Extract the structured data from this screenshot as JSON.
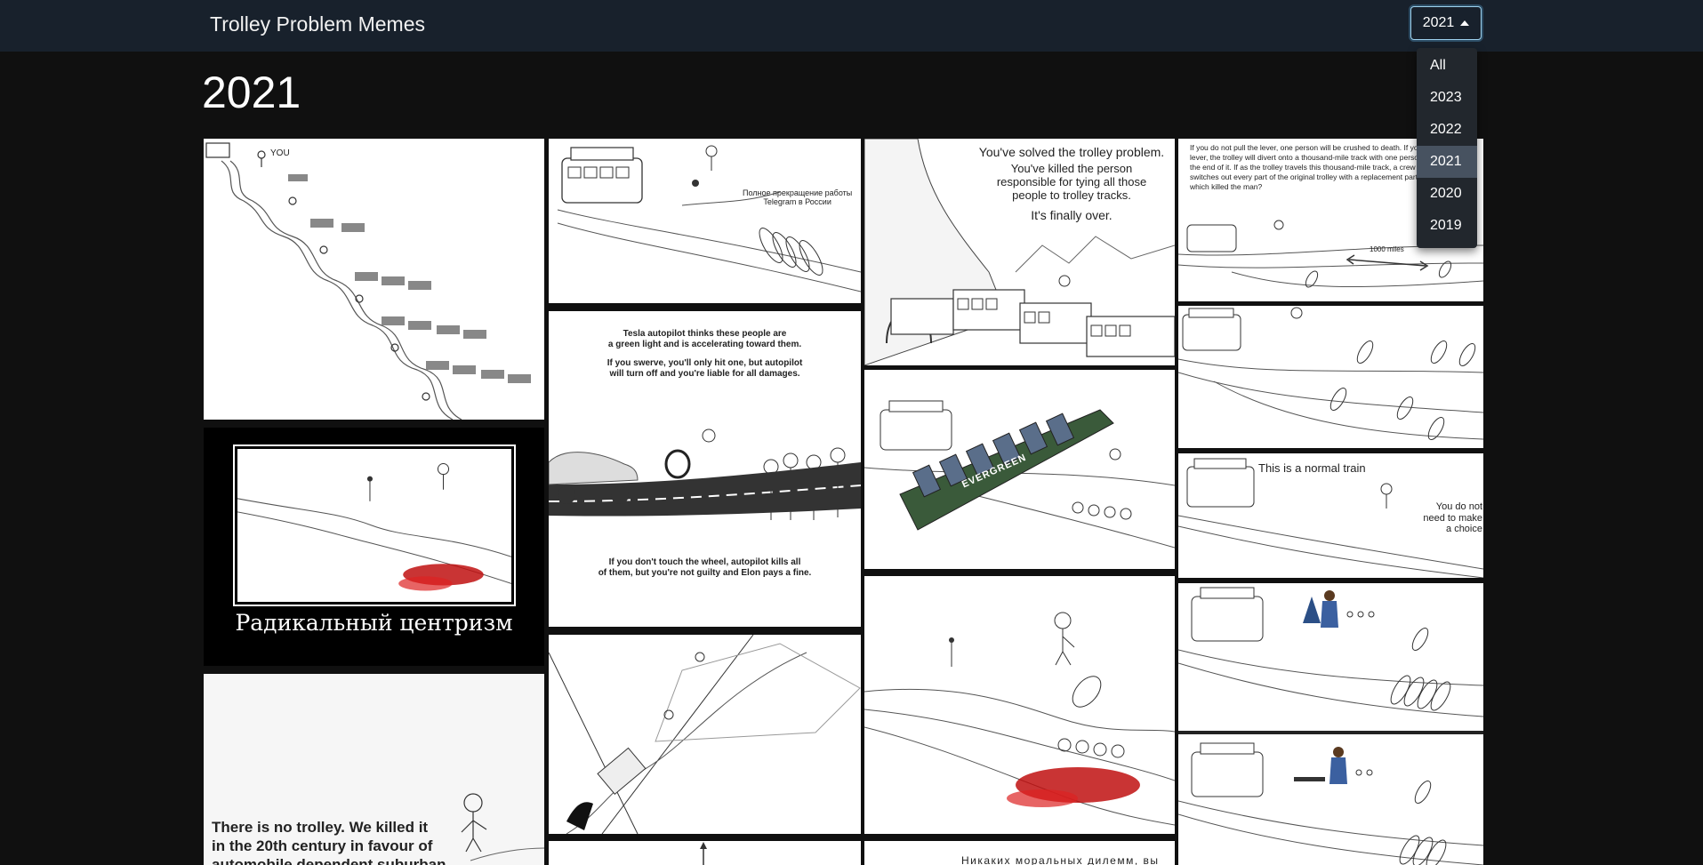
{
  "navbar": {
    "brand": "Trolley Problem Memes"
  },
  "year_selector": {
    "selected": "2021",
    "options": [
      "All",
      "2023",
      "2022",
      "2021",
      "2020",
      "2019"
    ]
  },
  "page": {
    "title": "2021"
  },
  "memes": {
    "m1_you": "YOU",
    "m2_caption_line1": "Полное прекращение работы",
    "m2_caption_line2": "Telegram в России",
    "m3_line1": "You've solved the trolley problem.",
    "m3_line2": "You've killed the person",
    "m3_line3": "responsible for tying all those",
    "m3_line4": "people to trolley tracks.",
    "m3_line5": "It's finally over.",
    "m4_text": "If you do not pull the lever, one person will be crushed to death. If you do pull the lever, the trolley will divert onto a thousand-mile track with one person tied down at the end of it. If as the trolley travels this thousand-mile track, a crew systematically switches out every part of the original trolley with a replacement part, did the trolley which killed the man?",
    "m4_miles": "1000 miles",
    "m5_line1": "Tesla autopilot thinks these people are",
    "m5_line2": "a green light and is accelerating toward them.",
    "m5_line3": "If you swerve, you'll only hit one, but autopilot",
    "m5_line4": "will turn off and you're liable for all damages.",
    "m5_line5": "If you don't touch the wheel, autopilot kills all",
    "m5_line6": "of them, but you're not guilty and Elon pays a fine.",
    "m6_brand": "EVERGREEN",
    "m7_caption": "Радикальный центризм",
    "m8_title": "This is a normal train",
    "m8_side_line1": "You do not",
    "m8_side_line2": "need to make",
    "m8_side_line3": "a choice",
    "m9_line1": "There is no trolley. We killed it",
    "m9_line2": "in the 20th century in favour of",
    "m9_line3": "automobile dependent suburban",
    "m10_text": "Никаких моральных дилемм, вы"
  }
}
